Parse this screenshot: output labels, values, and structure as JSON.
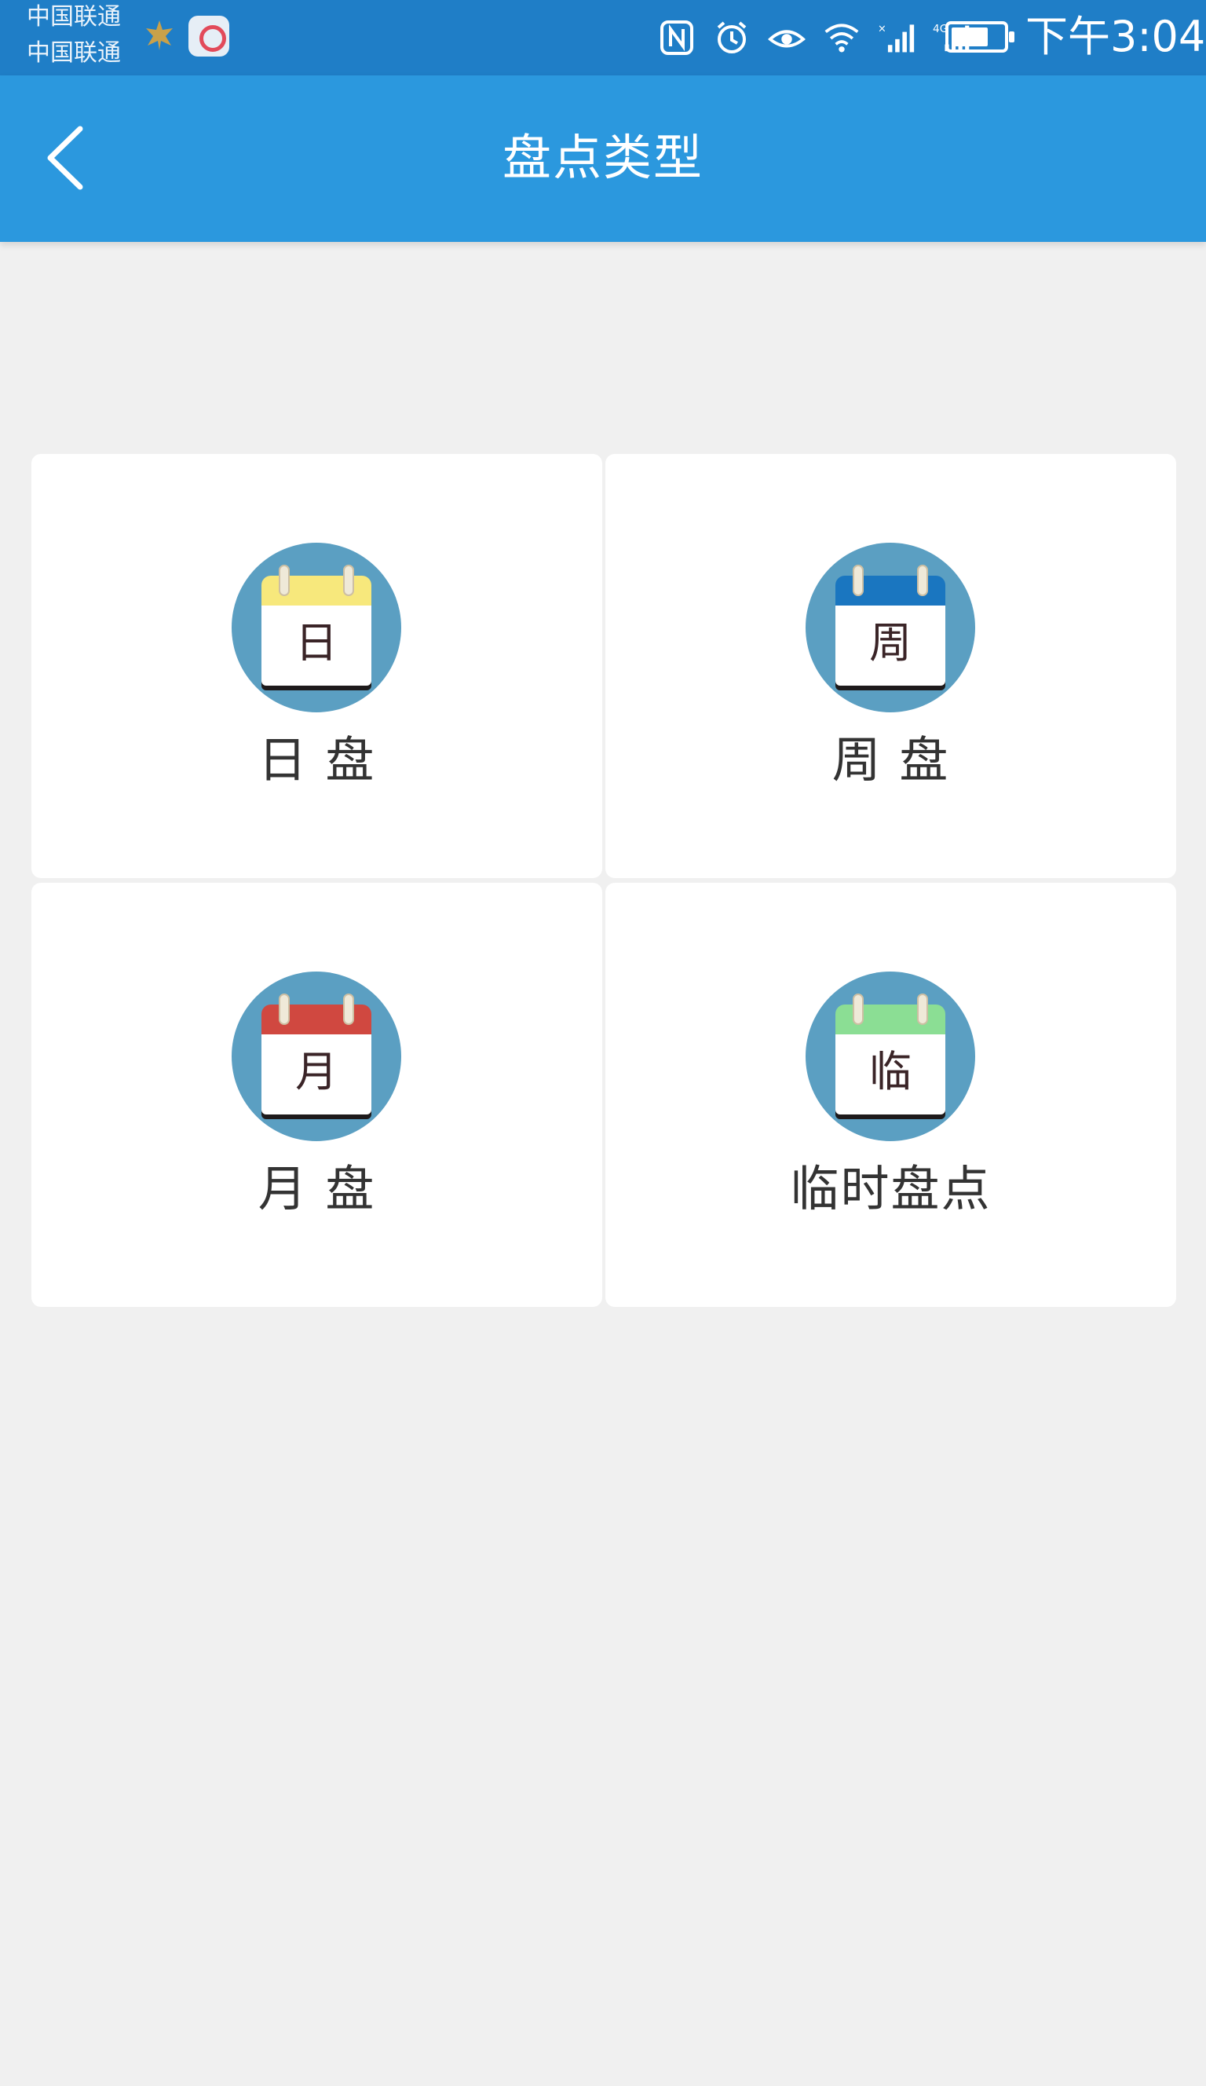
{
  "status_bar": {
    "carrier_1": "中国联通",
    "carrier_2": "中国联通",
    "icons": [
      "nfc-icon",
      "alarm-icon",
      "eye-comfort-icon",
      "wifi-icon",
      "signal-icon",
      "signal-4g-icon",
      "battery-icon"
    ],
    "time": "下午3:04"
  },
  "app_bar": {
    "title": "盘点类型",
    "back_icon": "chevron-left-icon"
  },
  "types": [
    {
      "label": "日 盘",
      "icon_char": "日",
      "header_color": "#f7e87c"
    },
    {
      "label": "周 盘",
      "icon_char": "周",
      "header_color": "#1a76c0"
    },
    {
      "label": "月 盘",
      "icon_char": "月",
      "header_color": "#d04840"
    },
    {
      "label": "临时盘点",
      "icon_char": "临",
      "header_color": "#8bde94"
    }
  ],
  "colors": {
    "app_bar": "#2b98de",
    "status_bar": "#1f7ec7",
    "icon_circle": "#5b9fc2",
    "background": "#f0f0f0"
  }
}
